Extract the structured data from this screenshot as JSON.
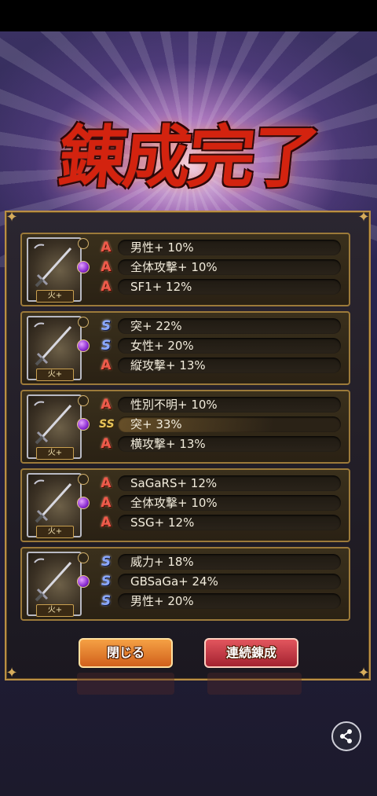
{
  "title": "錬成完了",
  "fire_label": "火+",
  "rows": [
    {
      "stats": [
        {
          "rank": "A",
          "text": "男性+ 10%"
        },
        {
          "rank": "A",
          "text": "全体攻撃+ 10%"
        },
        {
          "rank": "A",
          "text": "SF1+ 12%"
        }
      ]
    },
    {
      "stats": [
        {
          "rank": "S",
          "text": "突+ 22%"
        },
        {
          "rank": "S",
          "text": "女性+ 20%"
        },
        {
          "rank": "A",
          "text": "縦攻撃+ 13%"
        }
      ]
    },
    {
      "stats": [
        {
          "rank": "A",
          "text": "性別不明+ 10%"
        },
        {
          "rank": "SS",
          "text": "突+ 33%"
        },
        {
          "rank": "A",
          "text": "横攻撃+ 13%"
        }
      ]
    },
    {
      "stats": [
        {
          "rank": "A",
          "text": "SaGaRS+ 12%"
        },
        {
          "rank": "A",
          "text": "全体攻撃+ 10%"
        },
        {
          "rank": "A",
          "text": "SSG+ 12%"
        }
      ]
    },
    {
      "stats": [
        {
          "rank": "S",
          "text": "威力+ 18%"
        },
        {
          "rank": "S",
          "text": "GBSaGa+ 24%"
        },
        {
          "rank": "S",
          "text": "男性+ 20%"
        }
      ]
    }
  ],
  "buttons": {
    "close": "閉じる",
    "continue": "連続錬成"
  },
  "icons": {
    "share": "share-icon",
    "weapon": "sword-icon",
    "gem": "gem-icon"
  },
  "colors": {
    "rank_a": "#ee5a4a",
    "rank_s": "#8aa8ff",
    "rank_ss": "#e6c35a",
    "frame": "#b98f44"
  }
}
